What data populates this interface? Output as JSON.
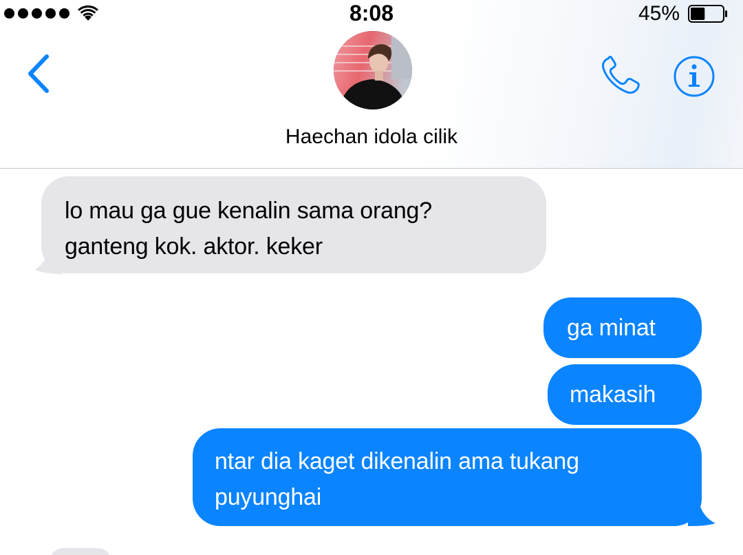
{
  "status_bar": {
    "time": "8:08",
    "battery_percent": "45%",
    "signal_bars": 5,
    "battery_level": 0.45
  },
  "header": {
    "contact_name": "Haechan idola cilik",
    "back_icon": "chevron-left-icon",
    "call_icon": "phone-icon",
    "info_icon": "info-icon",
    "accent_color": "#0a84ff"
  },
  "messages": [
    {
      "direction": "incoming",
      "lines": [
        "lo mau ga gue kenalin sama orang?",
        "ganteng kok. aktor. keker"
      ]
    },
    {
      "direction": "outgoing",
      "lines": [
        "ga minat"
      ]
    },
    {
      "direction": "outgoing",
      "lines": [
        "makasih"
      ]
    },
    {
      "direction": "outgoing",
      "lines": [
        "ntar dia kaget dikenalin ama tukang",
        "puyunghai"
      ]
    }
  ],
  "colors": {
    "incoming_bubble": "#e5e5ea",
    "outgoing_bubble": "#0a84ff",
    "divider": "#c9c9ce"
  }
}
